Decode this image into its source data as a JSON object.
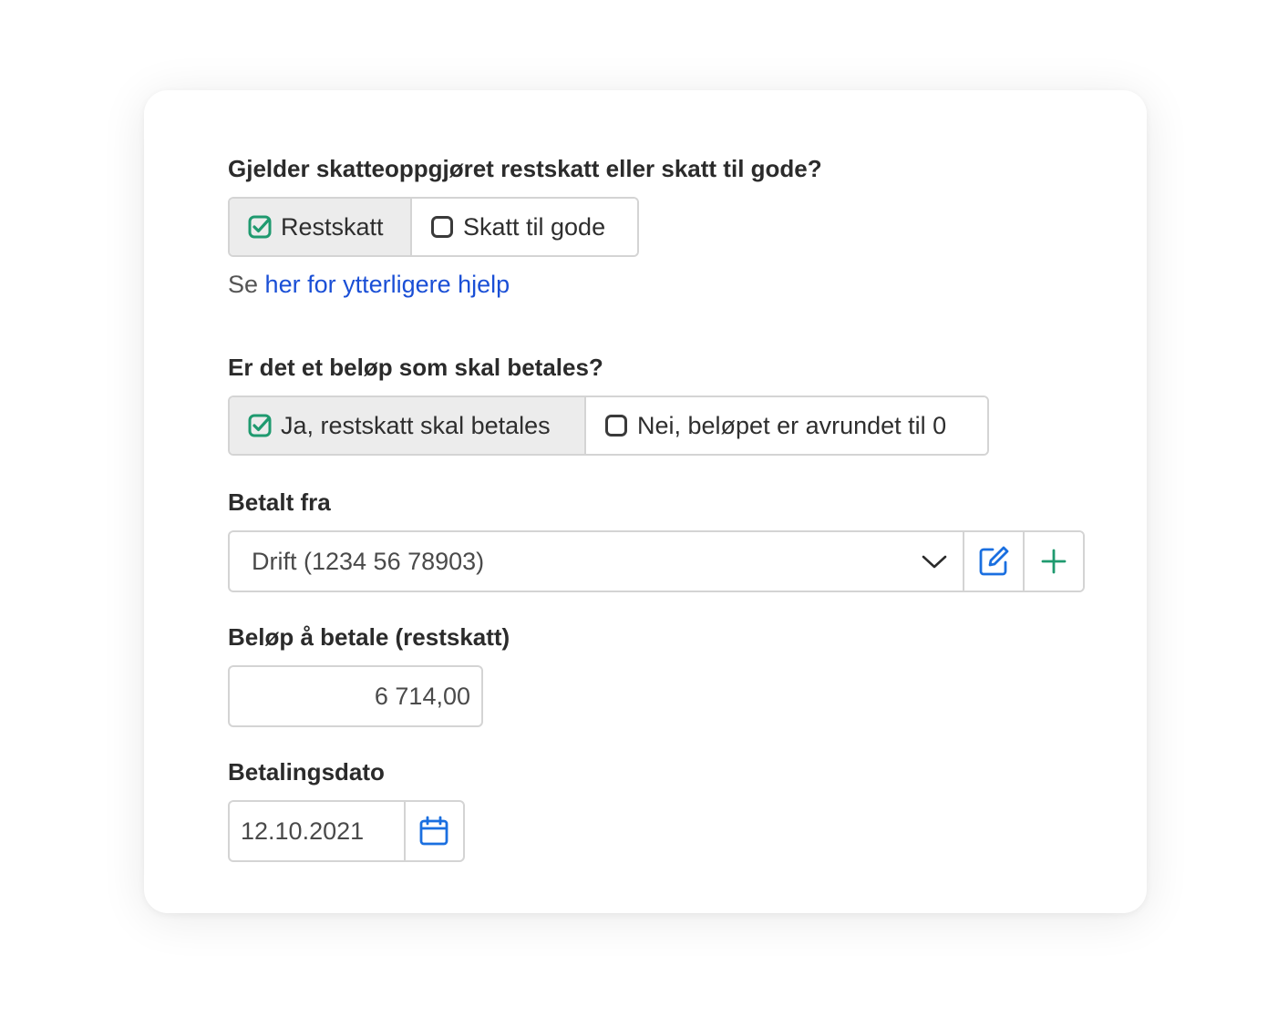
{
  "colors": {
    "accent_green": "#1f9a6f",
    "accent_blue": "#1a6fe0",
    "link_blue": "#1a4fd6"
  },
  "tax_type": {
    "question": "Gjelder skatteoppgjøret restskatt eller skatt til gode?",
    "options": [
      {
        "label": "Restskatt",
        "selected": true,
        "icon": "checkbox-checked-icon"
      },
      {
        "label": "Skatt til gode",
        "selected": false,
        "icon": "checkbox-empty-icon"
      }
    ],
    "help_prefix": "Se",
    "help_link": "her for ytterligere hjelp"
  },
  "payable": {
    "question": "Er det et beløp som skal betales?",
    "options": [
      {
        "label": "Ja, restskatt skal betales",
        "selected": true,
        "icon": "checkbox-checked-icon"
      },
      {
        "label": "Nei, beløpet er avrundet til 0",
        "selected": false,
        "icon": "checkbox-empty-icon"
      }
    ]
  },
  "paid_from": {
    "label": "Betalt fra",
    "value": "Drift (1234 56 78903)",
    "icons": [
      "chevron-down-icon",
      "edit-icon",
      "plus-icon"
    ]
  },
  "amount": {
    "label": "Beløp å betale (restskatt)",
    "value": "6 714,00"
  },
  "payment_date": {
    "label": "Betalingsdato",
    "value": "12.10.2021",
    "icon": "calendar-icon"
  }
}
